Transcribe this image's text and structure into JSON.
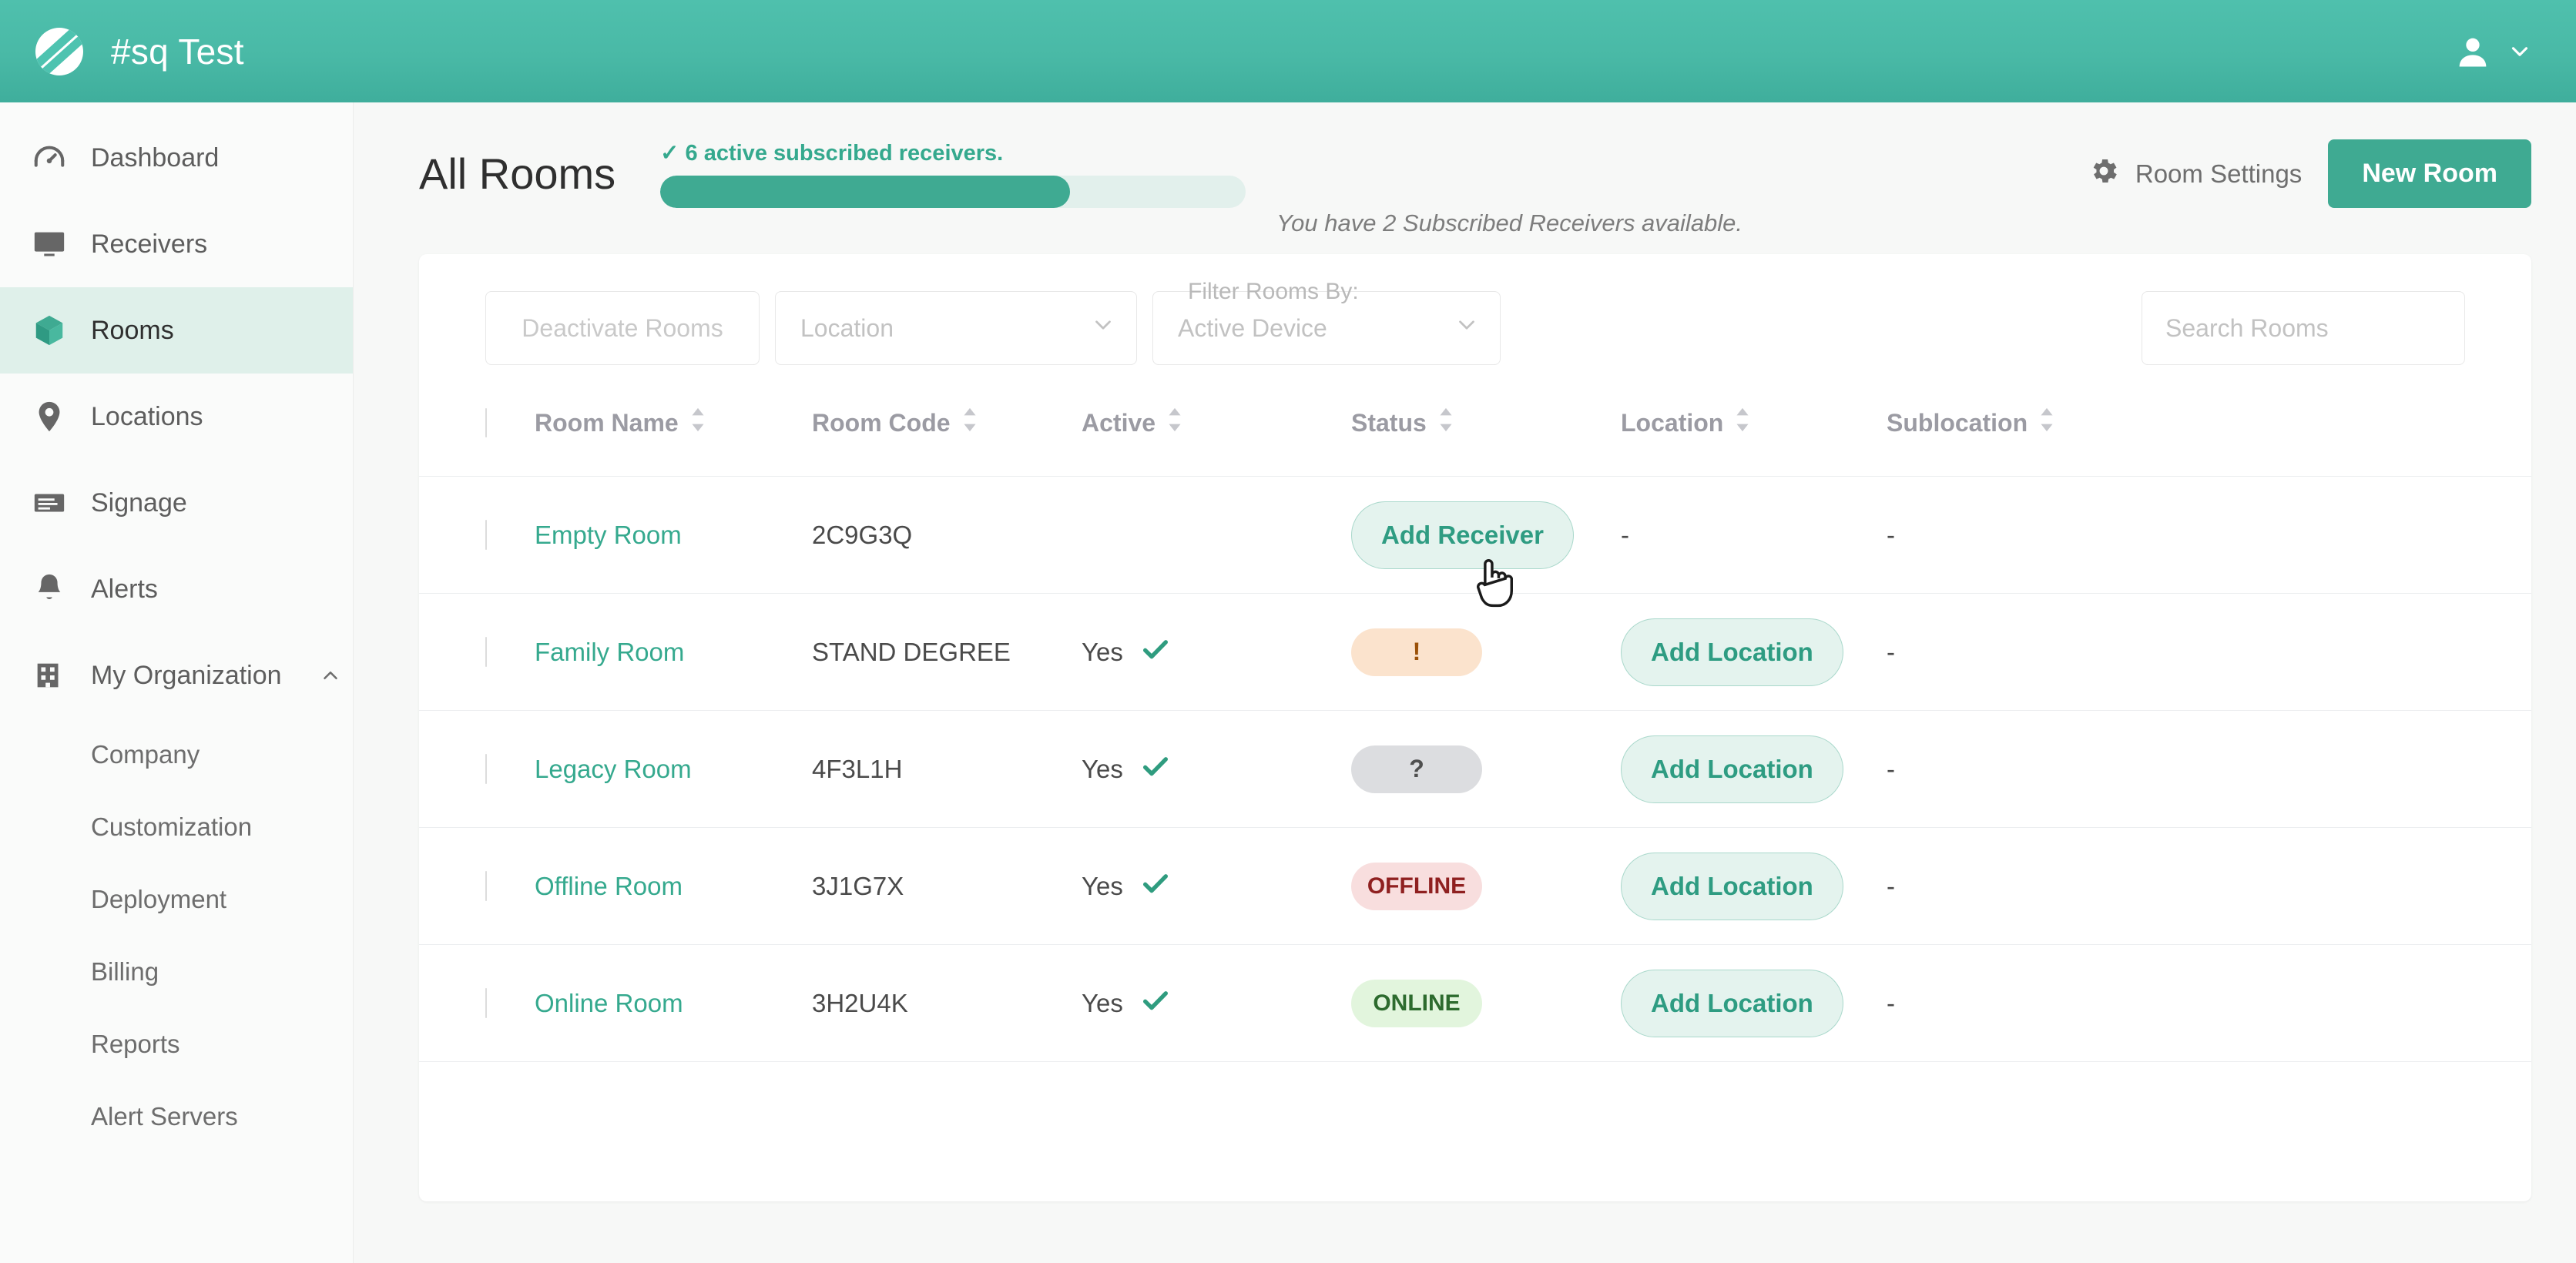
{
  "topbar": {
    "app_title": "#sq Test",
    "logo_icon": "circle-slash-logo",
    "user_icon": "user-avatar-icon",
    "chevron_icon": "chevron-down-icon"
  },
  "sidebar": {
    "items": [
      {
        "label": "Dashboard",
        "icon": "dashboard-gauge-icon",
        "active": false
      },
      {
        "label": "Receivers",
        "icon": "monitor-icon",
        "active": false
      },
      {
        "label": "Rooms",
        "icon": "box-3d-icon",
        "active": true
      },
      {
        "label": "Locations",
        "icon": "map-pin-icon",
        "active": false
      },
      {
        "label": "Signage",
        "icon": "signage-card-icon",
        "active": false
      },
      {
        "label": "Alerts",
        "icon": "bell-icon",
        "active": false
      },
      {
        "label": "My Organization",
        "icon": "building-icon",
        "active": false,
        "expanded": true
      }
    ],
    "sub_items": [
      {
        "label": "Company"
      },
      {
        "label": "Customization"
      },
      {
        "label": "Deployment"
      },
      {
        "label": "Billing"
      },
      {
        "label": "Reports"
      },
      {
        "label": "Alert Servers"
      }
    ]
  },
  "page": {
    "title": "All Rooms",
    "subscription_status": "✓ 6 active subscribed receivers.",
    "progress_percent": 70,
    "available_text": "You have 2 Subscribed Receivers available.",
    "room_settings_label": "Room Settings",
    "room_settings_icon": "gear-icon",
    "new_room_label": "New Room"
  },
  "filters": {
    "label": "Filter Rooms By:",
    "deactivate_label": "Deactivate Rooms",
    "location_placeholder": "Location",
    "device_placeholder": "Active Device",
    "search_placeholder": "Search Rooms",
    "search_value": ""
  },
  "table": {
    "columns": [
      {
        "label": "Room Name",
        "sortable": true
      },
      {
        "label": "Room Code",
        "sortable": true
      },
      {
        "label": "Active",
        "sortable": true
      },
      {
        "label": "Status",
        "sortable": true
      },
      {
        "label": "Location",
        "sortable": true
      },
      {
        "label": "Sublocation",
        "sortable": true
      }
    ],
    "rows": [
      {
        "name": "Empty Room",
        "code": "2C9G3Q",
        "active": "",
        "active_check": false,
        "status_type": "action",
        "status_text": "Add Receiver",
        "location_type": "dash",
        "location_text": "-",
        "sublocation": "-"
      },
      {
        "name": "Family Room",
        "code": "STAND DEGREE",
        "active": "Yes",
        "active_check": true,
        "status_type": "warn",
        "status_text": "!",
        "location_type": "action",
        "location_text": "Add Location",
        "sublocation": "-"
      },
      {
        "name": "Legacy Room",
        "code": "4F3L1H",
        "active": "Yes",
        "active_check": true,
        "status_type": "unknown",
        "status_text": "?",
        "location_type": "action",
        "location_text": "Add Location",
        "sublocation": "-"
      },
      {
        "name": "Offline Room",
        "code": "3J1G7X",
        "active": "Yes",
        "active_check": true,
        "status_type": "offline",
        "status_text": "OFFLINE",
        "location_type": "action",
        "location_text": "Add Location",
        "sublocation": "-"
      },
      {
        "name": "Online Room",
        "code": "3H2U4K",
        "active": "Yes",
        "active_check": true,
        "status_type": "online",
        "status_text": "ONLINE",
        "location_type": "action",
        "location_text": "Add Location",
        "sublocation": "-"
      }
    ]
  },
  "colors": {
    "brand_teal": "#3faa92",
    "header_teal": "#49b9a6",
    "link_green": "#35a98e",
    "active_nav_bg": "#dff0ea",
    "badge_warn_bg": "#fbe3cd",
    "badge_unknown_bg": "#dcdde0",
    "badge_offline_bg": "#f8dede",
    "badge_online_bg": "#e2f5dd"
  }
}
